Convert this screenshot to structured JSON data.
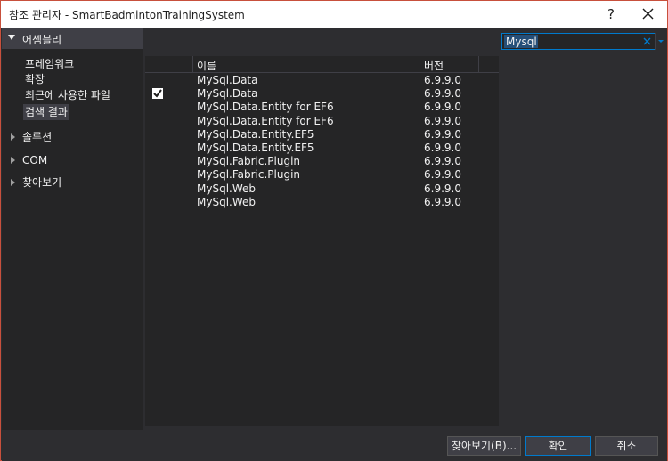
{
  "window": {
    "title": "참조 관리자 - SmartBadmintonTrainingSystem",
    "help_label": "?",
    "close_label": "✕"
  },
  "sidebar": {
    "header": "어셈블리",
    "sub_items": [
      "프레임워크",
      "확장",
      "최근에 사용한 파일",
      "검색 결과"
    ],
    "selected_index": 3,
    "groups": [
      "솔루션",
      "COM",
      "찾아보기"
    ]
  },
  "search": {
    "value": "Mysql"
  },
  "table": {
    "columns": [
      "이름",
      "버전"
    ],
    "rows": [
      {
        "name": "MySql.Data",
        "version": "6.9.9.0",
        "checked": false
      },
      {
        "name": "MySql.Data",
        "version": "6.9.9.0",
        "checked": true
      },
      {
        "name": "MySql.Data.Entity for EF6",
        "version": "6.9.9.0",
        "checked": false
      },
      {
        "name": "MySql.Data.Entity for EF6",
        "version": "6.9.9.0",
        "checked": false
      },
      {
        "name": "MySql.Data.Entity.EF5",
        "version": "6.9.9.0",
        "checked": false
      },
      {
        "name": "MySql.Data.Entity.EF5",
        "version": "6.9.9.0",
        "checked": false
      },
      {
        "name": "MySql.Fabric.Plugin",
        "version": "6.9.9.0",
        "checked": false
      },
      {
        "name": "MySql.Fabric.Plugin",
        "version": "6.9.9.0",
        "checked": false
      },
      {
        "name": "MySql.Web",
        "version": "6.9.9.0",
        "checked": false
      },
      {
        "name": "MySql.Web",
        "version": "6.9.9.0",
        "checked": false
      }
    ]
  },
  "footer": {
    "browse_label": "찾아보기(B)...",
    "ok_label": "확인",
    "cancel_label": "취소"
  },
  "colors": {
    "background": "#2d2d30",
    "panel": "#252526",
    "accent": "#007acc",
    "text": "#f1f1f1"
  }
}
